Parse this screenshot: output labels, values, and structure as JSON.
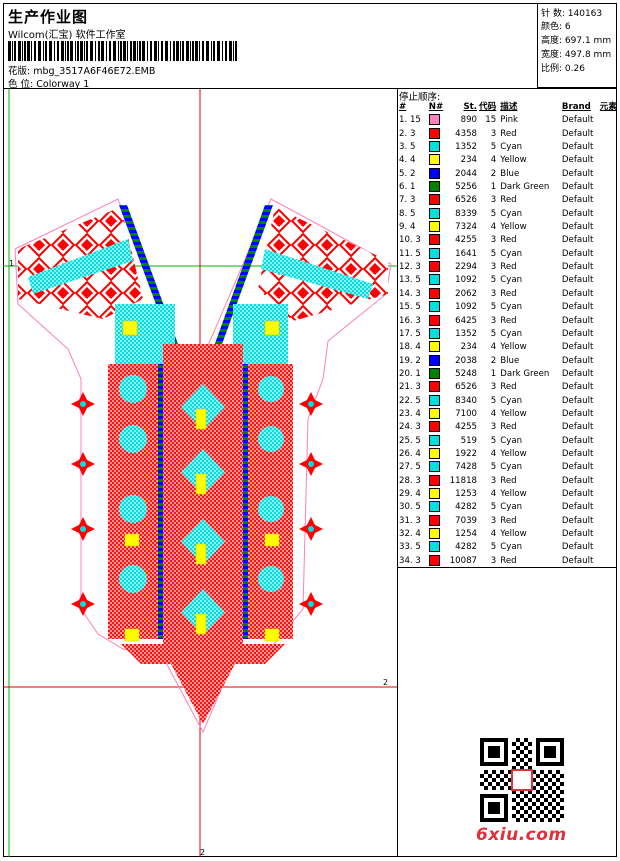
{
  "header": {
    "title": "生产作业图",
    "company": "Wilcom(汇宝) 软件工作室",
    "design_label": "花版:",
    "design_file": "mbg_3517A6F46E72.EMB",
    "colorway_label": "色 位:",
    "colorway": "Colorway 1"
  },
  "stats": [
    {
      "label": "针 数:",
      "value": "140163"
    },
    {
      "label": "颜色:",
      "value": "6"
    },
    {
      "label": "高度:",
      "value": "697.1 mm"
    },
    {
      "label": "宽度:",
      "value": "497.8 mm"
    },
    {
      "label": "比例:",
      "value": "0.26"
    }
  ],
  "design_markers": {
    "left_top": "1",
    "right_mid": "2",
    "bottom": "2"
  },
  "stop_sequence": {
    "title": "停止顺序:",
    "headers": [
      "#",
      "N#",
      "St.",
      "代码",
      "描述",
      "Brand",
      "元素"
    ],
    "rows": [
      {
        "idx": "1.",
        "n": "15",
        "st": "890",
        "code": "15",
        "desc": "Pink",
        "brand": "Default",
        "color": "#ff7fbf"
      },
      {
        "idx": "2.",
        "n": "3",
        "st": "4358",
        "code": "3",
        "desc": "Red",
        "brand": "Default",
        "color": "#ff0000"
      },
      {
        "idx": "3.",
        "n": "5",
        "st": "1352",
        "code": "5",
        "desc": "Cyan",
        "brand": "Default",
        "color": "#00e0e0"
      },
      {
        "idx": "4.",
        "n": "4",
        "st": "234",
        "code": "4",
        "desc": "Yellow",
        "brand": "Default",
        "color": "#ffff00"
      },
      {
        "idx": "5.",
        "n": "2",
        "st": "2044",
        "code": "2",
        "desc": "Blue",
        "brand": "Default",
        "color": "#0000ff"
      },
      {
        "idx": "6.",
        "n": "1",
        "st": "5256",
        "code": "1",
        "desc": "Dark Green",
        "brand": "Default",
        "color": "#008000"
      },
      {
        "idx": "7.",
        "n": "3",
        "st": "6526",
        "code": "3",
        "desc": "Red",
        "brand": "Default",
        "color": "#ff0000"
      },
      {
        "idx": "8.",
        "n": "5",
        "st": "8339",
        "code": "5",
        "desc": "Cyan",
        "brand": "Default",
        "color": "#00e0e0"
      },
      {
        "idx": "9.",
        "n": "4",
        "st": "7324",
        "code": "4",
        "desc": "Yellow",
        "brand": "Default",
        "color": "#ffff00"
      },
      {
        "idx": "10.",
        "n": "3",
        "st": "4255",
        "code": "3",
        "desc": "Red",
        "brand": "Default",
        "color": "#ff0000"
      },
      {
        "idx": "11.",
        "n": "5",
        "st": "1641",
        "code": "5",
        "desc": "Cyan",
        "brand": "Default",
        "color": "#00e0e0"
      },
      {
        "idx": "12.",
        "n": "3",
        "st": "2294",
        "code": "3",
        "desc": "Red",
        "brand": "Default",
        "color": "#ff0000"
      },
      {
        "idx": "13.",
        "n": "5",
        "st": "1092",
        "code": "5",
        "desc": "Cyan",
        "brand": "Default",
        "color": "#00e0e0"
      },
      {
        "idx": "14.",
        "n": "3",
        "st": "2062",
        "code": "3",
        "desc": "Red",
        "brand": "Default",
        "color": "#ff0000"
      },
      {
        "idx": "15.",
        "n": "5",
        "st": "1092",
        "code": "5",
        "desc": "Cyan",
        "brand": "Default",
        "color": "#00e0e0"
      },
      {
        "idx": "16.",
        "n": "3",
        "st": "6425",
        "code": "3",
        "desc": "Red",
        "brand": "Default",
        "color": "#ff0000"
      },
      {
        "idx": "17.",
        "n": "5",
        "st": "1352",
        "code": "5",
        "desc": "Cyan",
        "brand": "Default",
        "color": "#00e0e0"
      },
      {
        "idx": "18.",
        "n": "4",
        "st": "234",
        "code": "4",
        "desc": "Yellow",
        "brand": "Default",
        "color": "#ffff00"
      },
      {
        "idx": "19.",
        "n": "2",
        "st": "2038",
        "code": "2",
        "desc": "Blue",
        "brand": "Default",
        "color": "#0000ff"
      },
      {
        "idx": "20.",
        "n": "1",
        "st": "5248",
        "code": "1",
        "desc": "Dark Green",
        "brand": "Default",
        "color": "#008000"
      },
      {
        "idx": "21.",
        "n": "3",
        "st": "6526",
        "code": "3",
        "desc": "Red",
        "brand": "Default",
        "color": "#ff0000"
      },
      {
        "idx": "22.",
        "n": "5",
        "st": "8340",
        "code": "5",
        "desc": "Cyan",
        "brand": "Default",
        "color": "#00e0e0"
      },
      {
        "idx": "23.",
        "n": "4",
        "st": "7100",
        "code": "4",
        "desc": "Yellow",
        "brand": "Default",
        "color": "#ffff00"
      },
      {
        "idx": "24.",
        "n": "3",
        "st": "4255",
        "code": "3",
        "desc": "Red",
        "brand": "Default",
        "color": "#ff0000"
      },
      {
        "idx": "25.",
        "n": "5",
        "st": "519",
        "code": "5",
        "desc": "Cyan",
        "brand": "Default",
        "color": "#00e0e0"
      },
      {
        "idx": "26.",
        "n": "4",
        "st": "1922",
        "code": "4",
        "desc": "Yellow",
        "brand": "Default",
        "color": "#ffff00"
      },
      {
        "idx": "27.",
        "n": "5",
        "st": "7428",
        "code": "5",
        "desc": "Cyan",
        "brand": "Default",
        "color": "#00e0e0"
      },
      {
        "idx": "28.",
        "n": "3",
        "st": "11818",
        "code": "3",
        "desc": "Red",
        "brand": "Default",
        "color": "#ff0000"
      },
      {
        "idx": "29.",
        "n": "4",
        "st": "1253",
        "code": "4",
        "desc": "Yellow",
        "brand": "Default",
        "color": "#ffff00"
      },
      {
        "idx": "30.",
        "n": "5",
        "st": "4282",
        "code": "5",
        "desc": "Cyan",
        "brand": "Default",
        "color": "#00e0e0"
      },
      {
        "idx": "31.",
        "n": "3",
        "st": "7039",
        "code": "3",
        "desc": "Red",
        "brand": "Default",
        "color": "#ff0000"
      },
      {
        "idx": "32.",
        "n": "4",
        "st": "1254",
        "code": "4",
        "desc": "Yellow",
        "brand": "Default",
        "color": "#ffff00"
      },
      {
        "idx": "33.",
        "n": "5",
        "st": "4282",
        "code": "5",
        "desc": "Cyan",
        "brand": "Default",
        "color": "#00e0e0"
      },
      {
        "idx": "34.",
        "n": "3",
        "st": "10087",
        "code": "3",
        "desc": "Red",
        "brand": "Default",
        "color": "#ff0000"
      }
    ]
  },
  "watermark": "6xiu.com"
}
